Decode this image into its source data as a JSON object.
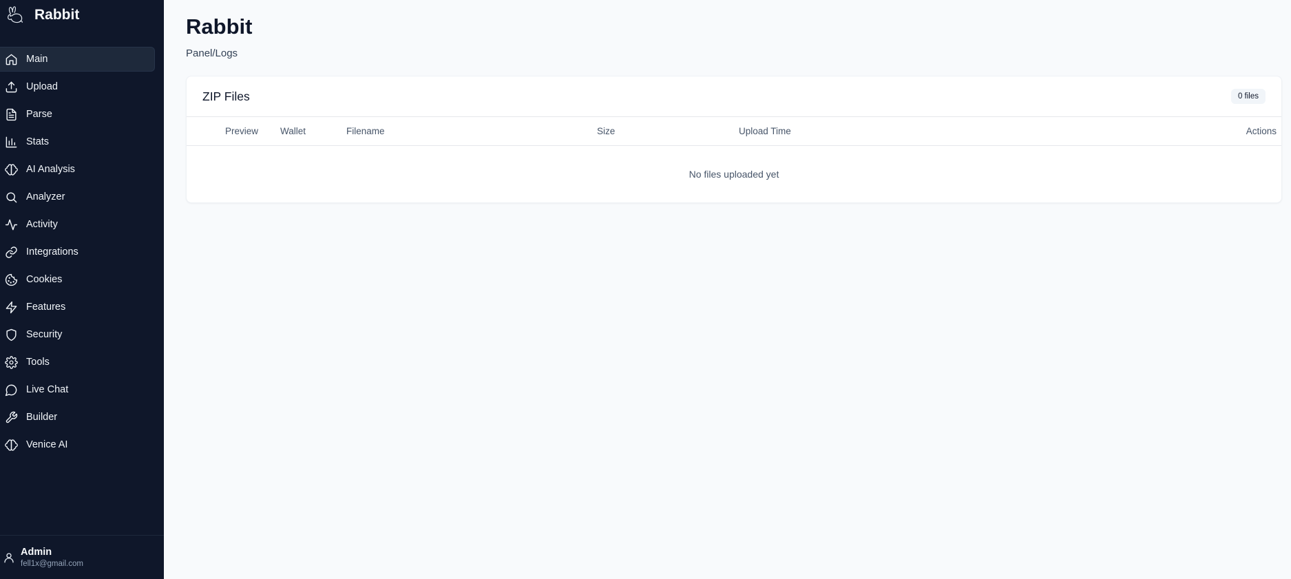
{
  "sidebar": {
    "brand": {
      "name": "Rabbit",
      "icon": "rabbit-icon"
    },
    "items": [
      {
        "label": "Main",
        "icon": "home-icon",
        "active": true
      },
      {
        "label": "Upload",
        "icon": "upload-icon"
      },
      {
        "label": "Parse",
        "icon": "file-text-icon"
      },
      {
        "label": "Stats",
        "icon": "bar-chart-icon"
      },
      {
        "label": "AI Analysis",
        "icon": "brain-icon"
      },
      {
        "label": "Analyzer",
        "icon": "search-icon"
      },
      {
        "label": "Activity",
        "icon": "activity-icon"
      },
      {
        "label": "Integrations",
        "icon": "link-icon"
      },
      {
        "label": "Cookies",
        "icon": "cookie-icon"
      },
      {
        "label": "Features",
        "icon": "zap-icon"
      },
      {
        "label": "Security",
        "icon": "shield-icon"
      },
      {
        "label": "Tools",
        "icon": "gear-icon"
      },
      {
        "label": "Live Chat",
        "icon": "chat-icon"
      },
      {
        "label": "Builder",
        "icon": "wrench-icon"
      },
      {
        "label": "Venice AI",
        "icon": "brain-icon"
      }
    ],
    "user": {
      "name": "Admin",
      "email": "fell1x@gmail.com",
      "icon": "user-icon"
    }
  },
  "header": {
    "title": "Rabbit",
    "breadcrumb": "Panel/Logs"
  },
  "card": {
    "title": "ZIP Files",
    "badge": "0 files",
    "columns": [
      "",
      "Preview",
      "Wallet",
      "Filename",
      "Size",
      "Upload Time",
      "Actions"
    ],
    "empty_text": "No files uploaded yet"
  },
  "colors": {
    "sidebar_bg": "#0f172a",
    "active_item_bg": "#1e293b",
    "main_bg": "#f8fafc",
    "card_bg": "#ffffff"
  }
}
